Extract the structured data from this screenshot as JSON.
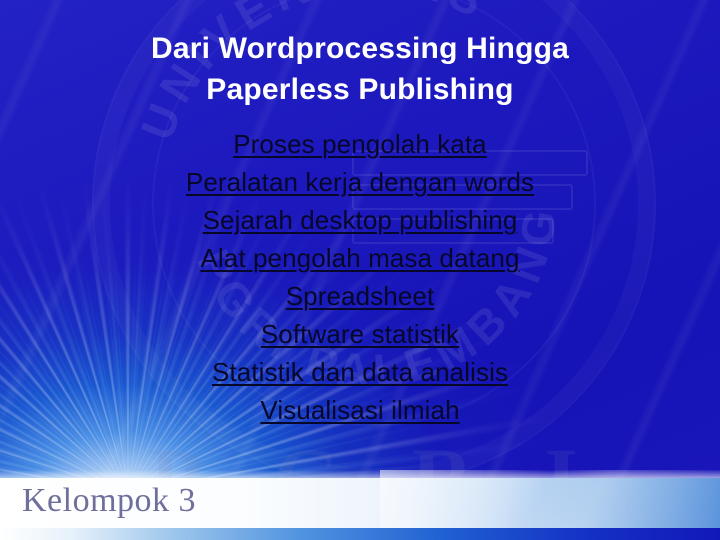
{
  "slide": {
    "title_line1": "Dari Wordprocessing Hingga",
    "title_line2": "Paperless Publishing",
    "bullets": [
      "Proses pengolah kata",
      "Peralatan kerja dengan words",
      "Sejarah desktop publishing",
      "Alat pengolah masa datang",
      "Spreadsheet",
      "Software statistik",
      "Statistik dan data analisis",
      "Visualisasi ilmiah"
    ],
    "footer_label": "Kelompok 3",
    "watermark": {
      "seal_text_top": "UNIVERSITAS",
      "seal_text_bottom": "PGRI PALEMBANG",
      "pgri_letters": [
        "P",
        "G",
        "R",
        "I"
      ]
    },
    "colors": {
      "background_deep_blue": "#1a18c0",
      "background_bright_blue": "#1272d8",
      "title_text": "#ffffff",
      "body_text": "#07072a",
      "footer_text": "#6f6f9c",
      "band_white": "#ffffff"
    }
  }
}
